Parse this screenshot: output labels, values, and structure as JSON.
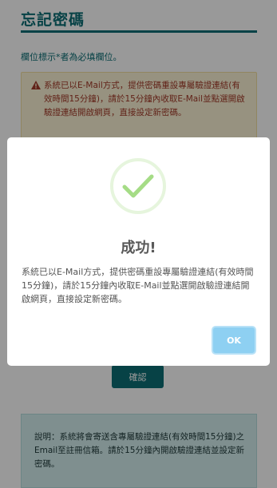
{
  "page": {
    "title": "忘記密碼",
    "required_note": "欄位標示*者為必填欄位。",
    "warning": {
      "icon": "warning-triangle-icon",
      "text": "系統已以E-Mail方式，提供密碼重設專屬驗證連結(有效時間15分鐘)，請於15分鐘內收取E-Mail並點選開啟驗證連結開啟網頁，直接設定新密碼。"
    },
    "confirm_label": "確認",
    "info_text": "說明：系統將會寄送含專屬驗證連結(有效時間15分鐘)之Email至註冊信箱。請於15分鐘內開啟驗證連結並設定新密碼。"
  },
  "modal": {
    "icon": "success-check-icon",
    "title": "成功!",
    "message": "系統已以E-Mail方式，提供密碼重設專屬驗證連結(有效時間15分鐘)，請於15分鐘內收取E-Mail並點選開啟驗證連結開啟網頁，直接設定新密碼。",
    "ok_label": "OK"
  },
  "colors": {
    "brand": "#0d6f76",
    "warning_bg": "#fcf3d6",
    "warning_text": "#a23a28",
    "success_green": "#a5dc86",
    "ok_button": "#8ed0f2"
  }
}
